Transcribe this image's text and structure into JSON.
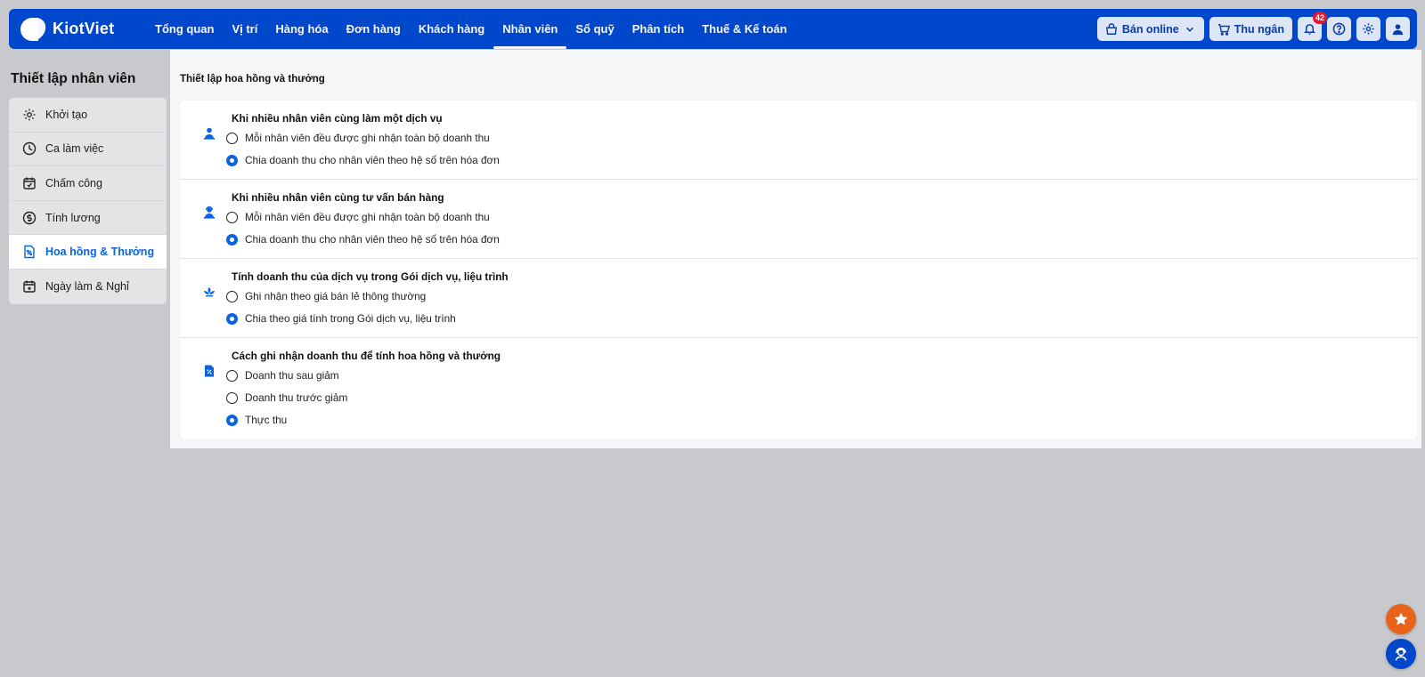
{
  "brand": {
    "name": "KiotViet"
  },
  "nav": {
    "items": [
      {
        "label": "Tổng quan",
        "active": false
      },
      {
        "label": "Vị trí",
        "active": false
      },
      {
        "label": "Hàng hóa",
        "active": false
      },
      {
        "label": "Đơn hàng",
        "active": false
      },
      {
        "label": "Khách hàng",
        "active": false
      },
      {
        "label": "Nhân viên",
        "active": true
      },
      {
        "label": "Sổ quỹ",
        "active": false
      },
      {
        "label": "Phân tích",
        "active": false
      },
      {
        "label": "Thuế & Kế toán",
        "active": false
      }
    ]
  },
  "top_right": {
    "online_label": "Bán online",
    "cashier_label": "Thu ngân",
    "notification_count": "42"
  },
  "sidebar": {
    "title": "Thiết lập nhân viên",
    "items": [
      {
        "label": "Khởi tạo",
        "icon": "gear-icon",
        "active": false
      },
      {
        "label": "Ca làm việc",
        "icon": "clock-icon",
        "active": false
      },
      {
        "label": "Chấm công",
        "icon": "calendar-check-icon",
        "active": false
      },
      {
        "label": "Tính lương",
        "icon": "dollar-circle-icon",
        "active": false
      },
      {
        "label": "Hoa hồng & Thưởng",
        "icon": "percent-document-icon",
        "active": true
      },
      {
        "label": "Ngày làm & Nghỉ",
        "icon": "calendar-star-icon",
        "active": false
      }
    ]
  },
  "main": {
    "title": "Thiết lập hoa hồng và thưởng",
    "sections": [
      {
        "heading": "Khi nhiều nhân viên cùng làm một dịch vụ",
        "icon": "staff-group-icon",
        "options": [
          {
            "label": "Mỗi nhân viên đều được ghi nhận toàn bộ doanh thu",
            "selected": false
          },
          {
            "label": "Chia doanh thu cho nhân viên theo hệ số trên hóa đơn",
            "selected": true
          }
        ]
      },
      {
        "heading": "Khi nhiều nhân viên cùng tư vấn bán hàng",
        "icon": "consultant-icon",
        "options": [
          {
            "label": "Mỗi nhân viên đều được ghi nhận toàn bộ doanh thu",
            "selected": false
          },
          {
            "label": "Chia doanh thu cho nhân viên theo hệ số trên hóa đơn",
            "selected": true
          }
        ]
      },
      {
        "heading": "Tính doanh thu của dịch vụ trong Gói dịch vụ, liệu trình",
        "icon": "lotus-icon",
        "options": [
          {
            "label": "Ghi nhận theo giá bán lẻ thông thường",
            "selected": false
          },
          {
            "label": "Chia theo giá tính trong Gói dịch vụ, liệu trình",
            "selected": true
          }
        ]
      },
      {
        "heading": "Cách ghi nhận doanh thu để tính hoa hồng và thưởng",
        "icon": "percent-document-icon",
        "options": [
          {
            "label": "Doanh thu sau giảm",
            "selected": false
          },
          {
            "label": "Doanh thu trước giảm",
            "selected": false
          },
          {
            "label": "Thực thu",
            "selected": true
          }
        ]
      }
    ]
  },
  "colors": {
    "brand_blue": "#0047cc",
    "accent": "#0a64e0",
    "fab_orange": "#e8641b",
    "fab_blue": "#0047cc"
  }
}
